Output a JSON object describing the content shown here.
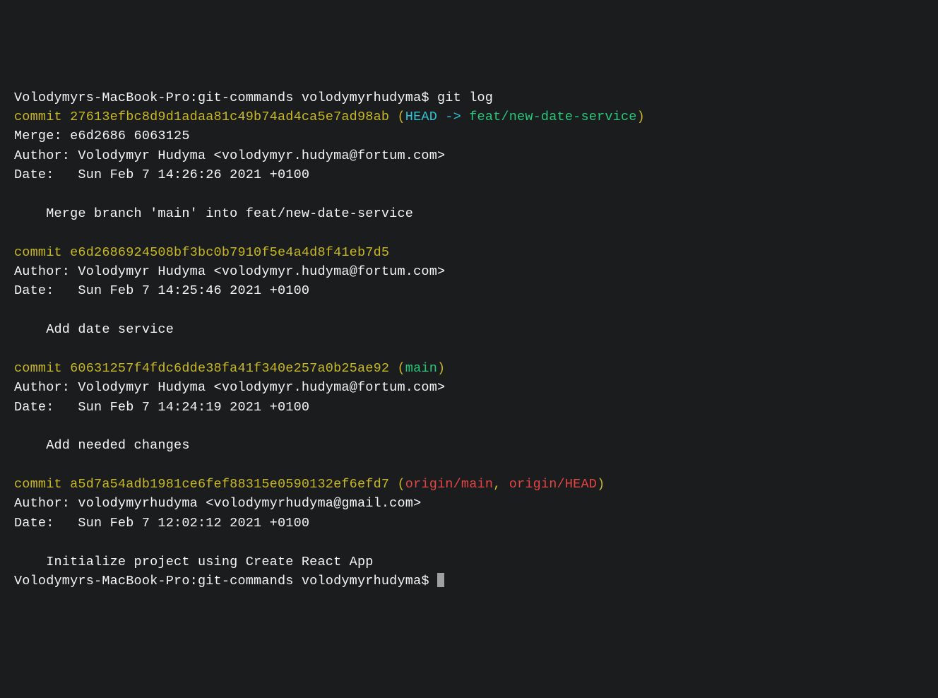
{
  "prompts": {
    "line1_prefix": "Volodymyrs-MacBook-Pro:git-commands volodymyrhudyma$ ",
    "line1_cmd": "git log",
    "line_end": "Volodymyrs-MacBook-Pro:git-commands volodymyrhudyma$ "
  },
  "commits": [
    {
      "commit_label": "commit 27613efbc8d9d1adaa81c49b74ad4ca5e7ad98ab",
      "ref_open": " (",
      "ref_head": "HEAD -> ",
      "ref_branch": "feat/new-date-service",
      "ref_close": ")",
      "merge": "Merge: e6d2686 6063125",
      "author": "Author: Volodymyr Hudyma <volodymyr.hudyma@fortum.com>",
      "date": "Date:   Sun Feb 7 14:26:26 2021 +0100",
      "message": "    Merge branch 'main' into feat/new-date-service"
    },
    {
      "commit_label": "commit e6d2686924508bf3bc0b7910f5e4a4d8f41eb7d5",
      "author": "Author: Volodymyr Hudyma <volodymyr.hudyma@fortum.com>",
      "date": "Date:   Sun Feb 7 14:25:46 2021 +0100",
      "message": "    Add date service"
    },
    {
      "commit_label": "commit 60631257f4fdc6dde38fa41f340e257a0b25ae92",
      "ref_open": " (",
      "ref_branch": "main",
      "ref_close": ")",
      "author": "Author: Volodymyr Hudyma <volodymyr.hudyma@fortum.com>",
      "date": "Date:   Sun Feb 7 14:24:19 2021 +0100",
      "message": "    Add needed changes"
    },
    {
      "commit_label": "commit a5d7a54adb1981ce6fef88315e0590132ef6efd7",
      "ref_open": " (",
      "ref_remote1": "origin/main",
      "ref_sep": ", ",
      "ref_remote2": "origin/HEAD",
      "ref_close": ")",
      "author": "Author: volodymyrhudyma <volodymyrhudyma@gmail.com>",
      "date": "Date:   Sun Feb 7 12:02:12 2021 +0100",
      "message": "    Initialize project using Create React App"
    }
  ]
}
